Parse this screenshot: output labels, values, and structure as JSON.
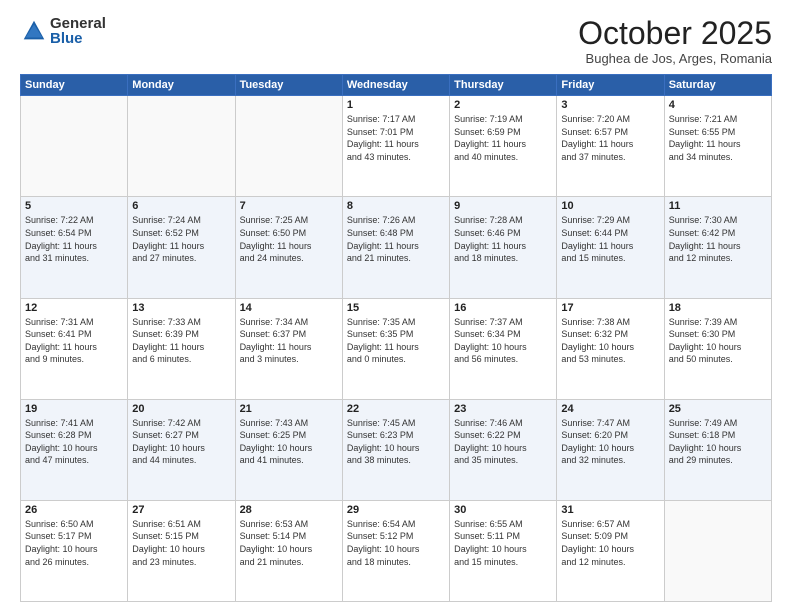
{
  "logo": {
    "general": "General",
    "blue": "Blue"
  },
  "title": "October 2025",
  "subtitle": "Bughea de Jos, Arges, Romania",
  "days_of_week": [
    "Sunday",
    "Monday",
    "Tuesday",
    "Wednesday",
    "Thursday",
    "Friday",
    "Saturday"
  ],
  "weeks": [
    [
      {
        "num": "",
        "info": ""
      },
      {
        "num": "",
        "info": ""
      },
      {
        "num": "",
        "info": ""
      },
      {
        "num": "1",
        "info": "Sunrise: 7:17 AM\nSunset: 7:01 PM\nDaylight: 11 hours\nand 43 minutes."
      },
      {
        "num": "2",
        "info": "Sunrise: 7:19 AM\nSunset: 6:59 PM\nDaylight: 11 hours\nand 40 minutes."
      },
      {
        "num": "3",
        "info": "Sunrise: 7:20 AM\nSunset: 6:57 PM\nDaylight: 11 hours\nand 37 minutes."
      },
      {
        "num": "4",
        "info": "Sunrise: 7:21 AM\nSunset: 6:55 PM\nDaylight: 11 hours\nand 34 minutes."
      }
    ],
    [
      {
        "num": "5",
        "info": "Sunrise: 7:22 AM\nSunset: 6:54 PM\nDaylight: 11 hours\nand 31 minutes."
      },
      {
        "num": "6",
        "info": "Sunrise: 7:24 AM\nSunset: 6:52 PM\nDaylight: 11 hours\nand 27 minutes."
      },
      {
        "num": "7",
        "info": "Sunrise: 7:25 AM\nSunset: 6:50 PM\nDaylight: 11 hours\nand 24 minutes."
      },
      {
        "num": "8",
        "info": "Sunrise: 7:26 AM\nSunset: 6:48 PM\nDaylight: 11 hours\nand 21 minutes."
      },
      {
        "num": "9",
        "info": "Sunrise: 7:28 AM\nSunset: 6:46 PM\nDaylight: 11 hours\nand 18 minutes."
      },
      {
        "num": "10",
        "info": "Sunrise: 7:29 AM\nSunset: 6:44 PM\nDaylight: 11 hours\nand 15 minutes."
      },
      {
        "num": "11",
        "info": "Sunrise: 7:30 AM\nSunset: 6:42 PM\nDaylight: 11 hours\nand 12 minutes."
      }
    ],
    [
      {
        "num": "12",
        "info": "Sunrise: 7:31 AM\nSunset: 6:41 PM\nDaylight: 11 hours\nand 9 minutes."
      },
      {
        "num": "13",
        "info": "Sunrise: 7:33 AM\nSunset: 6:39 PM\nDaylight: 11 hours\nand 6 minutes."
      },
      {
        "num": "14",
        "info": "Sunrise: 7:34 AM\nSunset: 6:37 PM\nDaylight: 11 hours\nand 3 minutes."
      },
      {
        "num": "15",
        "info": "Sunrise: 7:35 AM\nSunset: 6:35 PM\nDaylight: 11 hours\nand 0 minutes."
      },
      {
        "num": "16",
        "info": "Sunrise: 7:37 AM\nSunset: 6:34 PM\nDaylight: 10 hours\nand 56 minutes."
      },
      {
        "num": "17",
        "info": "Sunrise: 7:38 AM\nSunset: 6:32 PM\nDaylight: 10 hours\nand 53 minutes."
      },
      {
        "num": "18",
        "info": "Sunrise: 7:39 AM\nSunset: 6:30 PM\nDaylight: 10 hours\nand 50 minutes."
      }
    ],
    [
      {
        "num": "19",
        "info": "Sunrise: 7:41 AM\nSunset: 6:28 PM\nDaylight: 10 hours\nand 47 minutes."
      },
      {
        "num": "20",
        "info": "Sunrise: 7:42 AM\nSunset: 6:27 PM\nDaylight: 10 hours\nand 44 minutes."
      },
      {
        "num": "21",
        "info": "Sunrise: 7:43 AM\nSunset: 6:25 PM\nDaylight: 10 hours\nand 41 minutes."
      },
      {
        "num": "22",
        "info": "Sunrise: 7:45 AM\nSunset: 6:23 PM\nDaylight: 10 hours\nand 38 minutes."
      },
      {
        "num": "23",
        "info": "Sunrise: 7:46 AM\nSunset: 6:22 PM\nDaylight: 10 hours\nand 35 minutes."
      },
      {
        "num": "24",
        "info": "Sunrise: 7:47 AM\nSunset: 6:20 PM\nDaylight: 10 hours\nand 32 minutes."
      },
      {
        "num": "25",
        "info": "Sunrise: 7:49 AM\nSunset: 6:18 PM\nDaylight: 10 hours\nand 29 minutes."
      }
    ],
    [
      {
        "num": "26",
        "info": "Sunrise: 6:50 AM\nSunset: 5:17 PM\nDaylight: 10 hours\nand 26 minutes."
      },
      {
        "num": "27",
        "info": "Sunrise: 6:51 AM\nSunset: 5:15 PM\nDaylight: 10 hours\nand 23 minutes."
      },
      {
        "num": "28",
        "info": "Sunrise: 6:53 AM\nSunset: 5:14 PM\nDaylight: 10 hours\nand 21 minutes."
      },
      {
        "num": "29",
        "info": "Sunrise: 6:54 AM\nSunset: 5:12 PM\nDaylight: 10 hours\nand 18 minutes."
      },
      {
        "num": "30",
        "info": "Sunrise: 6:55 AM\nSunset: 5:11 PM\nDaylight: 10 hours\nand 15 minutes."
      },
      {
        "num": "31",
        "info": "Sunrise: 6:57 AM\nSunset: 5:09 PM\nDaylight: 10 hours\nand 12 minutes."
      },
      {
        "num": "",
        "info": ""
      }
    ]
  ]
}
